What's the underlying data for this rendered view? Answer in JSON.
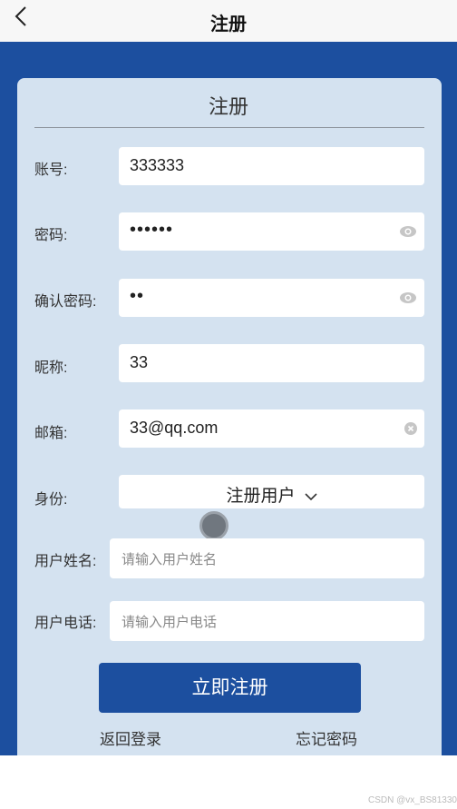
{
  "header": {
    "title": "注册"
  },
  "card": {
    "title": "注册"
  },
  "form": {
    "account": {
      "label": "账号:",
      "value": "333333"
    },
    "password": {
      "label": "密码:",
      "value": "••••••"
    },
    "confirm_password": {
      "label": "确认密码:",
      "value": "••"
    },
    "nickname": {
      "label": "昵称:",
      "value": "33"
    },
    "email": {
      "label": "邮箱:",
      "value": "33@qq.com"
    },
    "identity": {
      "label": "身份:",
      "value": "注册用户"
    },
    "user_name": {
      "label": "用户姓名:",
      "placeholder": "请输入用户姓名"
    },
    "user_phone": {
      "label": "用户电话:",
      "placeholder": "请输入用户电话"
    }
  },
  "actions": {
    "submit_label": "立即注册",
    "back_login": "返回登录",
    "forgot_password": "忘记密码"
  },
  "watermark": "CSDN @vx_BS81330",
  "colors": {
    "primary": "#1c4f9f",
    "card": "#d4e2f0"
  },
  "icons": {
    "back": "chevron-left-icon",
    "eye": "eye-icon",
    "clear": "clear-icon",
    "dropdown": "chevron-down-icon"
  }
}
